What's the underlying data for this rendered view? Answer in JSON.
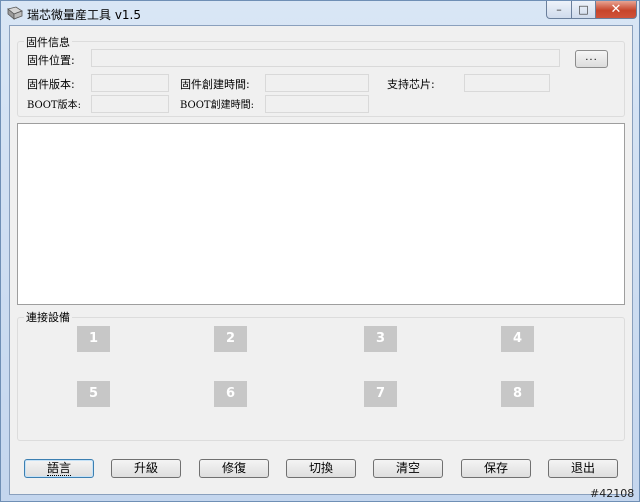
{
  "window": {
    "title": "瑞芯微量産工具 v1.5",
    "controls": {
      "minimize": "–",
      "maximize": "□",
      "close": "✕"
    }
  },
  "firmware_group": {
    "title": "固件信息",
    "location_label": "固件位置:",
    "location_value": "",
    "browse_label": "...",
    "version_label": "固件版本:",
    "version_value": "",
    "build_time_label": "固件創建時間:",
    "build_time_value": "",
    "chip_label": "支持芯片:",
    "chip_value": "",
    "boot_version_label": "BOOT版本:",
    "boot_version_value": "",
    "boot_build_time_label": "BOOT創建時間:",
    "boot_build_time_value": ""
  },
  "log": {
    "text": ""
  },
  "devices_group": {
    "title": "連接設備",
    "slots": [
      "1",
      "2",
      "3",
      "4",
      "5",
      "6",
      "7",
      "8"
    ]
  },
  "buttons": {
    "language": "語言",
    "upgrade": "升級",
    "repair": "修復",
    "switch": "切換",
    "clear": "清空",
    "save": "保存",
    "exit": "退出"
  },
  "watermark": "#42108",
  "colors": {
    "device_slot": "#c7c7c7",
    "close_button": "#c7452b",
    "titlebar": "#c4d6ee"
  },
  "icons": {
    "app": "app-icon"
  }
}
